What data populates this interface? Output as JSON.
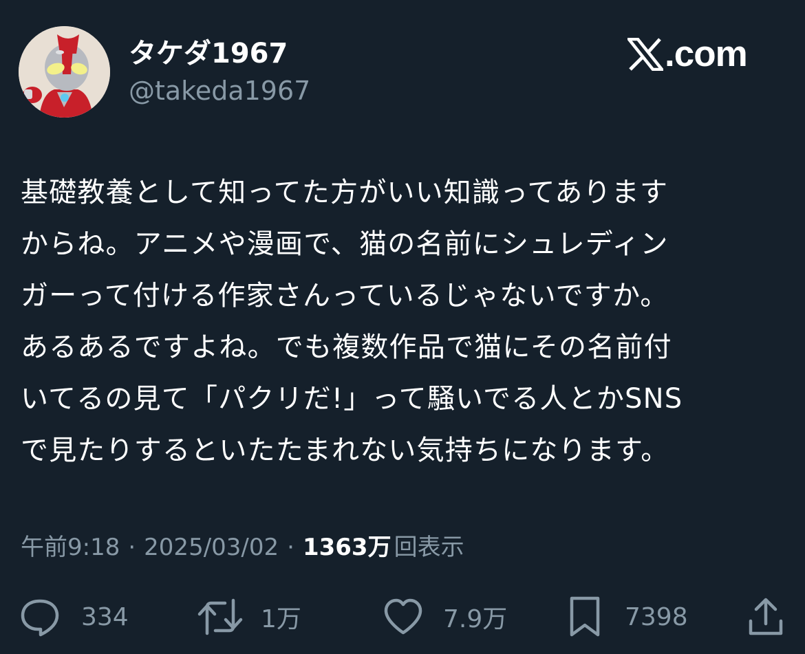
{
  "author": {
    "display_name": "タケダ1967",
    "handle": "@takeda1967",
    "avatar_icon": "ultraman-figure-avatar"
  },
  "brand": {
    "icon": "x-logo-icon",
    "text": ".com"
  },
  "post": {
    "lines": [
      "基礎教養として知ってた方がいい知識ってあります",
      "からね。アニメや漫画で、猫の名前にシュレディン",
      "ガーって付ける作家さんっているじゃないですか。",
      "あるあるですよね。でも複数作品で猫にその名前付",
      "いてるの見て「パクリだ!」って騒いでる人とかSNS",
      "で見たりするといたたまれない気持ちになります。"
    ]
  },
  "meta": {
    "time": "午前9:18",
    "separator": "·",
    "date": "2025/03/02",
    "views_count": "1363万",
    "views_label": "回表示"
  },
  "actions": {
    "replies": {
      "icon": "reply-bubble-icon",
      "count": "334"
    },
    "reposts": {
      "icon": "repost-icon",
      "count": "1万"
    },
    "likes": {
      "icon": "heart-icon",
      "count": "7.9万"
    },
    "bookmarks": {
      "icon": "bookmark-icon",
      "count": "7398"
    },
    "share": {
      "icon": "share-icon"
    }
  },
  "colors": {
    "background": "#15202b",
    "primary_text": "#ffffff",
    "secondary_text": "#8899a6"
  }
}
